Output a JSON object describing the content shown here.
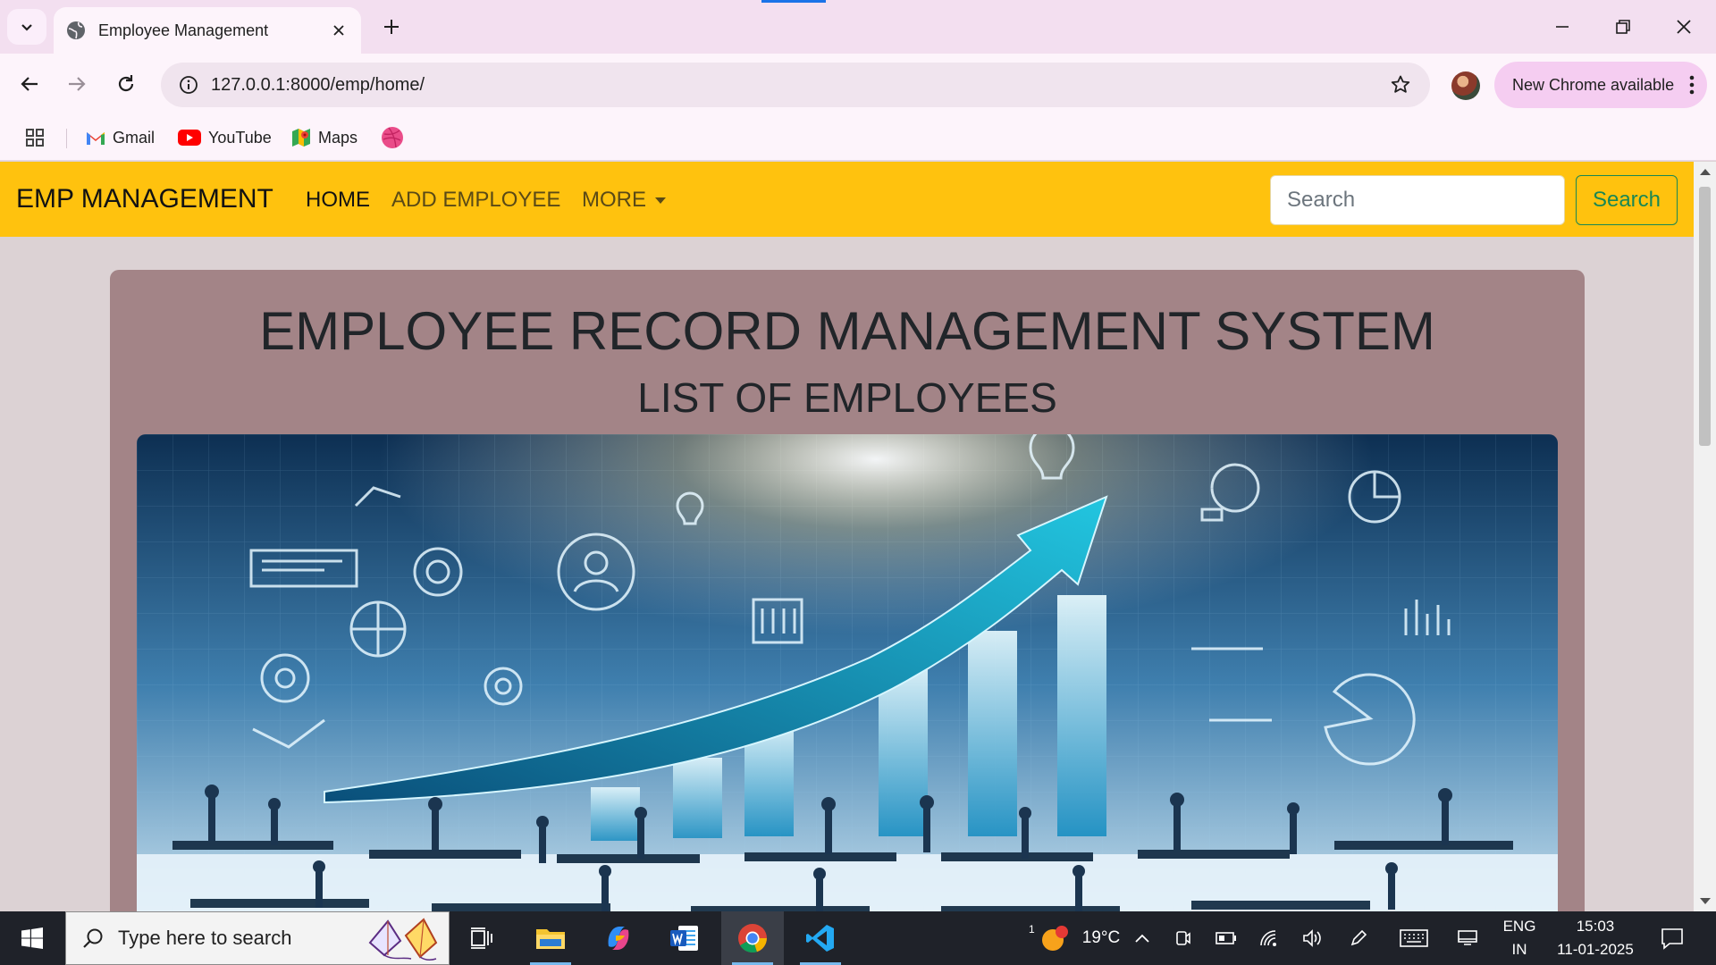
{
  "browser": {
    "tab_title": "Employee Management",
    "url": "127.0.0.1:8000/emp/home/",
    "update_label": "New Chrome available",
    "bookmarks": [
      {
        "label": "Gmail",
        "icon": "gmail-icon"
      },
      {
        "label": "YouTube",
        "icon": "youtube-icon"
      },
      {
        "label": "Maps",
        "icon": "maps-icon"
      },
      {
        "label": "",
        "icon": "dribbble-icon"
      }
    ]
  },
  "navbar": {
    "brand": "EMP MANAGEMENT",
    "links": [
      "HOME",
      "ADD EMPLOYEE",
      "MORE"
    ],
    "search_placeholder": "Search",
    "search_button": "Search",
    "color": "#ffc20e"
  },
  "main": {
    "title": "EMPLOYEE RECORD MANAGEMENT SYSTEM",
    "subtitle": "LIST OF EMPLOYEES",
    "card_color": "#a38487",
    "hero_image": "business-growth-illustration"
  },
  "taskbar": {
    "search_placeholder": "Type here to search",
    "apps": [
      "task-view-icon",
      "file-explorer-icon",
      "copilot-icon",
      "word-icon",
      "chrome-icon",
      "vscode-icon"
    ],
    "weather": "19°C",
    "weather_badge": "1",
    "language": "ENG",
    "region": "IN",
    "time": "15:03",
    "date": "11-01-2025"
  }
}
